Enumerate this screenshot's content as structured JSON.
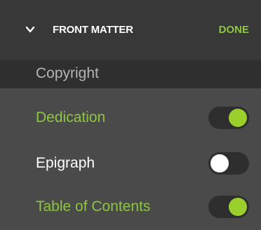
{
  "header": {
    "collapse_icon": "chevron-down-icon",
    "title": "FRONT MATTER",
    "done_label": "DONE"
  },
  "items": [
    {
      "label": "Copyright",
      "selected": true
    },
    {
      "label": "Dedication",
      "enabled": true
    },
    {
      "label": "Epigraph",
      "enabled": false
    },
    {
      "label": "Table of Contents",
      "enabled": true
    }
  ],
  "colors": {
    "accent": "#8dc63f",
    "toggle_on_knob": "#9bd02c",
    "panel_bg": "#4a4a4a",
    "header_bg": "#383838",
    "selected_row_bg": "#2f2f2f"
  }
}
